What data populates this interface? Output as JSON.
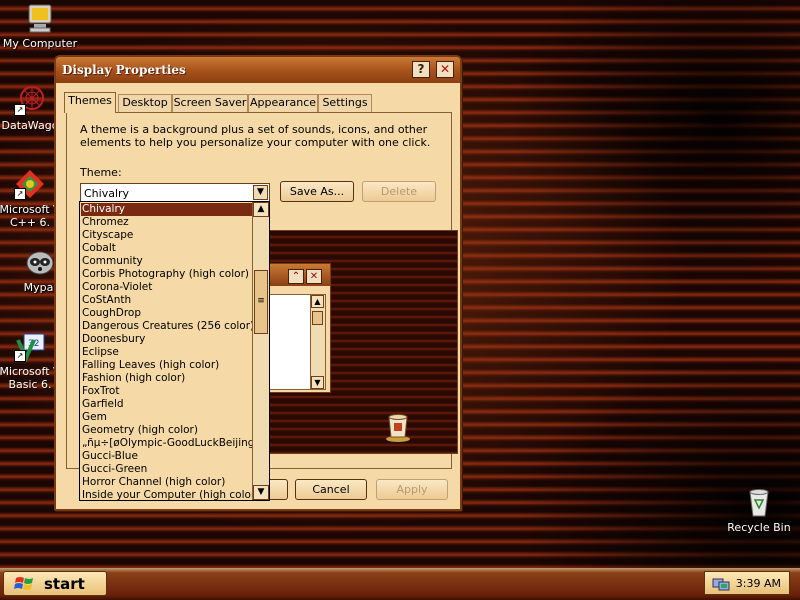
{
  "desktop": {
    "icons": [
      {
        "label_lines": [
          "My Computer"
        ]
      },
      {
        "label_lines": [
          "DataWago"
        ]
      },
      {
        "label_lines": [
          "Microsoft V",
          "C++ 6."
        ]
      },
      {
        "label_lines": [
          "Mypal"
        ]
      },
      {
        "label_lines": [
          "Microsoft V",
          "Basic 6."
        ]
      },
      {
        "label_lines": [
          "Recycle Bin"
        ]
      }
    ]
  },
  "window": {
    "title": "Display Properties",
    "help_glyph": "?",
    "close_glyph": "✕",
    "tabs": [
      "Themes",
      "Desktop",
      "Screen Saver",
      "Appearance",
      "Settings"
    ],
    "active_tab": "Themes",
    "description": "A theme is a background plus a set of sounds, icons, and other elements to help you personalize your computer with one click.",
    "theme_label": "Theme:",
    "theme_value": "Chivalry",
    "save_as_label": "Save As...",
    "delete_label": "Delete",
    "ok_label": "",
    "cancel_label": "Cancel",
    "apply_label": "Apply"
  },
  "theme_list": {
    "items": [
      "Chivalry",
      "Chromez",
      "Cityscape",
      "Cobalt",
      "Community",
      "Corbis Photography (high color)",
      "Corona-Violet",
      "CoStAnth",
      "CoughDrop",
      "Dangerous Creatures (256 color)",
      "Doonesbury",
      "Eclipse",
      "Falling Leaves (high color)",
      "Fashion (high color)",
      "FoxTrot",
      "Garfield",
      "Gem",
      "Geometry (high color)",
      "„ñµ÷[øOlympic-GoodLuckBeijing",
      "Gucci-Blue",
      "Gucci-Green",
      "Horror Channel (high color)",
      "Inside your Computer (high color)"
    ],
    "selected": "Chivalry"
  },
  "taskbar": {
    "start_label": "start",
    "clock": "3:39 AM"
  },
  "colors": {
    "titlebar": "#a9531c",
    "window_face": "#f5d9a6",
    "selection": "#7a2a10"
  }
}
